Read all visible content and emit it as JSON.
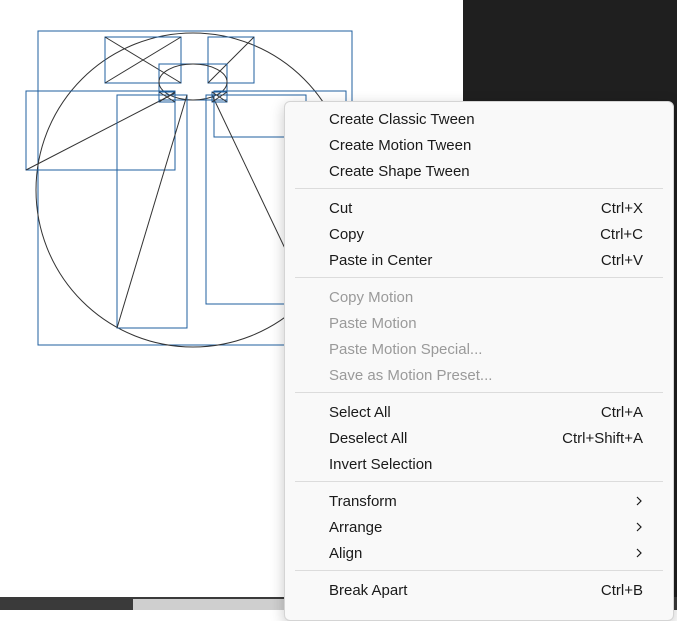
{
  "context_menu": {
    "groups": [
      {
        "items": [
          {
            "label": "Create Classic Tween"
          },
          {
            "label": "Create Motion Tween"
          },
          {
            "label": "Create Shape Tween"
          }
        ]
      },
      {
        "items": [
          {
            "label": "Cut",
            "shortcut": "Ctrl+X"
          },
          {
            "label": "Copy",
            "shortcut": "Ctrl+C"
          },
          {
            "label": "Paste in Center",
            "shortcut": "Ctrl+V"
          }
        ]
      },
      {
        "items": [
          {
            "label": "Copy Motion",
            "disabled": true
          },
          {
            "label": "Paste Motion",
            "disabled": true
          },
          {
            "label": "Paste Motion Special...",
            "disabled": true
          },
          {
            "label": "Save as Motion Preset...",
            "disabled": true
          }
        ]
      },
      {
        "items": [
          {
            "label": "Select All",
            "shortcut": "Ctrl+A"
          },
          {
            "label": "Deselect All",
            "shortcut": "Ctrl+Shift+A"
          },
          {
            "label": "Invert Selection"
          }
        ]
      },
      {
        "items": [
          {
            "label": "Transform",
            "submenu": true
          },
          {
            "label": "Arrange",
            "submenu": true
          },
          {
            "label": "Align",
            "submenu": true
          }
        ]
      },
      {
        "items": [
          {
            "label": "Break Apart",
            "shortcut": "Ctrl+B"
          }
        ]
      }
    ]
  },
  "colors": {
    "selection_outline": "#1f5f9f",
    "stroke": "#333333",
    "workspace_dark": "#1f1f1f"
  }
}
